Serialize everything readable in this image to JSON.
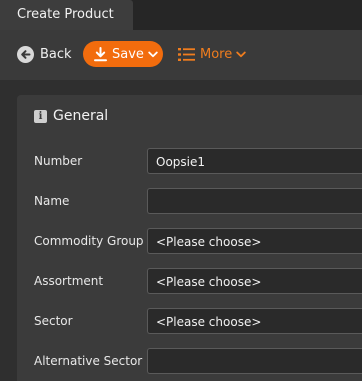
{
  "tab": {
    "title": "Create Product"
  },
  "toolbar": {
    "back_label": "Back",
    "save_label": "Save",
    "more_label": "More",
    "accent": "#f26c0d"
  },
  "section": {
    "title": "General",
    "icon": "info-icon"
  },
  "fields": [
    {
      "label": "Number",
      "value": "Oopsie1"
    },
    {
      "label": "Name",
      "value": ""
    },
    {
      "label": "Commodity Group",
      "value": "<Please choose>"
    },
    {
      "label": "Assortment",
      "value": "<Please choose>"
    },
    {
      "label": "Sector",
      "value": "<Please choose>"
    },
    {
      "label": "Alternative Sector",
      "value": ""
    }
  ]
}
